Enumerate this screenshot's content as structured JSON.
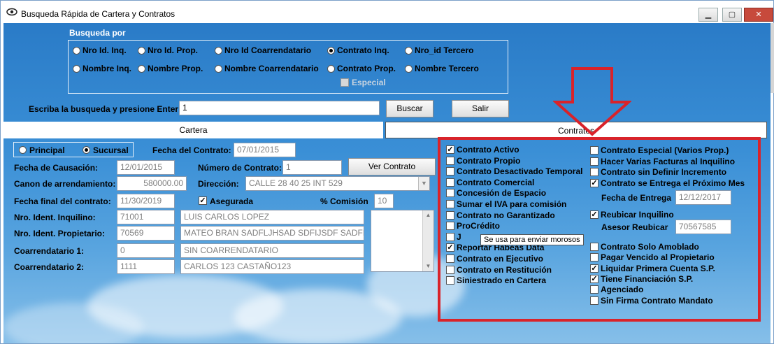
{
  "window": {
    "title": "Busqueda Rápida de Cartera y Contratos"
  },
  "search_group": {
    "title": "Busqueda por",
    "options": [
      {
        "label": "Nro Id. Inq.",
        "selected": false
      },
      {
        "label": "Nro Id. Prop.",
        "selected": false
      },
      {
        "label": "Nro Id Coarrendatario",
        "selected": false
      },
      {
        "label": "Contrato Inq.",
        "selected": true
      },
      {
        "label": "Nro_id Tercero",
        "selected": false
      },
      {
        "label": "Nombre Inq.",
        "selected": false
      },
      {
        "label": "Nombre Prop.",
        "selected": false
      },
      {
        "label": "Nombre Coarrendatario",
        "selected": false
      },
      {
        "label": "Contrato Prop.",
        "selected": false
      },
      {
        "label": "Nombre Tercero",
        "selected": false
      }
    ],
    "especial_label": "Especial"
  },
  "search_bar": {
    "label": "Escriba la busqueda y presione Enter",
    "value": "1",
    "search_button": "Buscar",
    "exit_button": "Salir"
  },
  "tabs": [
    {
      "label": "Cartera"
    },
    {
      "label": "Contratos"
    }
  ],
  "scope": {
    "principal": "Principal",
    "sucursal": "Sucursal"
  },
  "fields": {
    "fecha_contrato_label": "Fecha del Contrato:",
    "fecha_contrato": "07/01/2015",
    "fecha_causacion_label": "Fecha de Causación:",
    "fecha_causacion": "12/01/2015",
    "numero_contrato_label": "Número de Contrato:",
    "numero_contrato": "1",
    "ver_contrato": "Ver Contrato",
    "canon_label": "Canon de arrendamiento:",
    "canon": "580000.00",
    "direccion_label": "Dirección:",
    "direccion": "CALLE 28 40 25 INT 529",
    "fecha_final_label": "Fecha final del contrato:",
    "fecha_final": "11/30/2019",
    "asegurada_label": "Asegurada",
    "comision_label": "% Comisión",
    "comision": "10",
    "inquilino_label": "Nro. Ident. Inquilino:",
    "inquilino_id": "71001",
    "inquilino_nombre": "LUIS CARLOS LOPEZ",
    "propietario_label": "Nro. Ident. Propietario:",
    "propietario_id": "70569",
    "propietario_nombre": "MATEO BRAN SADFLJHSAD SDFIJSDF SADFI:",
    "coarr1_label": "Coarrendatario 1:",
    "coarr1_id": "0",
    "coarr1_nombre": "SIN COARRENDATARIO",
    "coarr2_label": "Coarrendatario 2:",
    "coarr2_id": "1111",
    "coarr2_nombre": "CARLOS 123 CASTAÑO123"
  },
  "contract_flags_left": [
    {
      "label": "Contrato Activo",
      "checked": true
    },
    {
      "label": "Contrato Propio",
      "checked": false
    },
    {
      "label": "Contrato Desactivado Temporal",
      "checked": false
    },
    {
      "label": "Contrato Comercial",
      "checked": false
    },
    {
      "label": "Concesión de Espacio",
      "checked": false
    },
    {
      "label": "Sumar el IVA para comisión",
      "checked": false
    },
    {
      "label": "Contrato no Garantizado",
      "checked": false
    },
    {
      "label": "ProCrédito",
      "checked": false
    },
    {
      "label": "J",
      "checked": false
    },
    {
      "label": "Reportar Habeas Data",
      "checked": true
    },
    {
      "label": "Contrato en Ejecutivo",
      "checked": false
    },
    {
      "label": "Contrato en Restitución",
      "checked": false
    },
    {
      "label": "Siniestrado en Cartera",
      "checked": false
    }
  ],
  "contract_flags_right": [
    {
      "label": "Contrato Especial (Varios Prop.)",
      "checked": false
    },
    {
      "label": "Hacer Varias Facturas al Inquilino",
      "checked": false
    },
    {
      "label": "Contrato sin Definir Incremento",
      "checked": false
    },
    {
      "label": "Contrato se Entrega el Próximo Mes",
      "checked": true
    }
  ],
  "entrega": {
    "label": "Fecha de Entrega",
    "value": "12/12/2017"
  },
  "reubicar": {
    "label": "Reubicar Inquilino",
    "checked": true,
    "asesor_label": "Asesor Reubicar",
    "asesor_value": "70567585"
  },
  "contract_flags_right2": [
    {
      "label": "Contrato Solo Amoblado",
      "checked": false
    },
    {
      "label": "Pagar Vencido al Propietario",
      "checked": false
    },
    {
      "label": "Liquidar Primera Cuenta S.P.",
      "checked": true
    },
    {
      "label": "Tiene Financiación S.P.",
      "checked": true
    },
    {
      "label": "Agenciado",
      "checked": false
    },
    {
      "label": "Sin Firma Contrato Mandato",
      "checked": false
    }
  ],
  "tooltip": "Se usa para enviar morosos",
  "colors": {
    "highlight": "#d9232a",
    "background": "#3a8fd6"
  }
}
